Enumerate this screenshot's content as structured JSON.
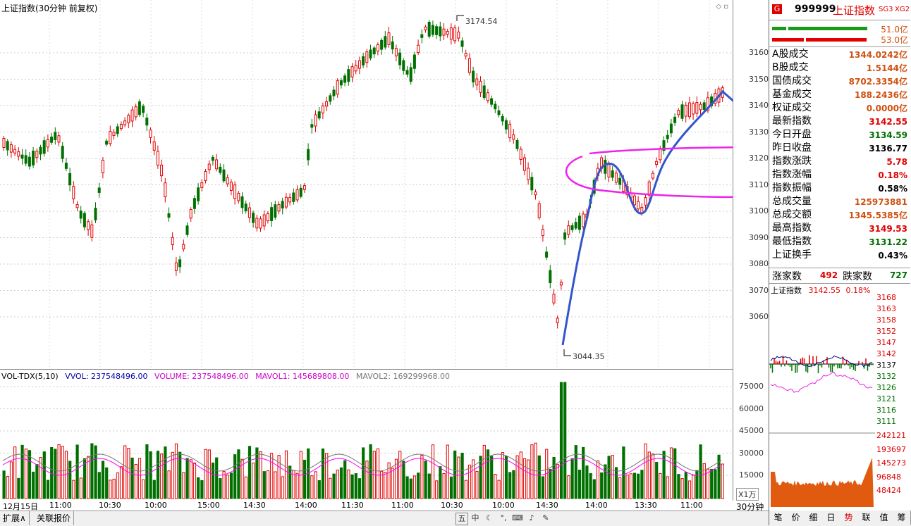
{
  "chart_title": "上证指数(30分钟 前复权)",
  "high_label": "3174.54",
  "low_label": "3044.35",
  "price_ticks": [
    "3160",
    "3150",
    "3140",
    "3130",
    "3120",
    "3110",
    "3100",
    "3090",
    "3080",
    "3070",
    "3060"
  ],
  "vol_ticks": [
    "75000",
    "60000",
    "45000",
    "30000",
    "15000"
  ],
  "vol_unit": "X1万",
  "period": "30分钟",
  "vol_legend": {
    "name": "VOL-TDX(5,10)",
    "vvol": "VVOL: 237548496.00",
    "volume": "VOLUME: 237548496.00",
    "mavol1": "MAVOL1: 145689808.00",
    "mavol2": "MAVOL2: 169299968.00"
  },
  "x_labels": [
    "12月15日",
    "11:00",
    "10:30",
    "10:00",
    "15:00",
    "14:30",
    "14:00",
    "11:30",
    "11:00",
    "10:30",
    "10:00",
    "14:30",
    "14:00",
    "13:30",
    "11:00"
  ],
  "bottom_tabs": [
    "扩展∧",
    "关联报价"
  ],
  "toolbar_icons": [
    "五",
    "中",
    "moon-icon",
    "dot-icon",
    "keyboard-icon",
    "speaker-icon",
    "tool-icon"
  ],
  "side": {
    "badge": "G",
    "code": "999999",
    "name": "上证指数",
    "tag1": "SG3",
    "tag2": "XG2",
    "bar1_value": "51.0亿",
    "bar2_value": "53.0亿",
    "rows": [
      {
        "label": "A股成交",
        "value": "1344.0242亿",
        "color": "orange"
      },
      {
        "label": "B股成交",
        "value": "1.5144亿",
        "color": "orange"
      },
      {
        "label": "国债成交",
        "value": "8702.3354亿",
        "color": "orange"
      },
      {
        "label": "基金成交",
        "value": "188.2436亿",
        "color": "orange"
      },
      {
        "label": "权证成交",
        "value": "0.0000亿",
        "color": "orange"
      },
      {
        "label": "最新指数",
        "value": "3142.55",
        "color": "red"
      },
      {
        "label": "今日开盘",
        "value": "3134.59",
        "color": "green"
      },
      {
        "label": "昨日收盘",
        "value": "3136.77",
        "color": "black"
      },
      {
        "label": "指数涨跌",
        "value": "5.78",
        "color": "red"
      },
      {
        "label": "指数涨幅",
        "value": "0.18%",
        "color": "red"
      },
      {
        "label": "指数振幅",
        "value": "0.58%",
        "color": "black"
      },
      {
        "label": "总成交量",
        "value": "125973881",
        "color": "orange"
      },
      {
        "label": "总成交额",
        "value": "1345.5385亿",
        "color": "orange"
      },
      {
        "label": "最高指数",
        "value": "3149.53",
        "color": "red"
      },
      {
        "label": "最低指数",
        "value": "3131.22",
        "color": "green"
      },
      {
        "label": "上证换手",
        "value": "0.43%",
        "color": "black"
      }
    ],
    "rise_label": "涨家数",
    "rise_value": "492",
    "fall_label": "跌家数",
    "fall_value": "727",
    "mini_title": "上证指数",
    "mini_price": "3142.55",
    "mini_pct": "0.18%",
    "mini_price_ticks": [
      "3168",
      "3163",
      "3158",
      "3152",
      "3147",
      "3142",
      "3137",
      "3132",
      "3126",
      "3121",
      "3116",
      "3111"
    ],
    "mini_vol_ticks": [
      "242121",
      "193697",
      "145273",
      "96848",
      "48424"
    ],
    "tabs": [
      "笔",
      "价",
      "细",
      "日",
      "势",
      "联",
      "值",
      "筹"
    ]
  },
  "colors": {
    "up": "#e00000",
    "down": "#007000",
    "ma1": "#ff00ff",
    "ma2": "#777777",
    "annot_blue": "#3355cc",
    "annot_magenta": "#ee22ee"
  }
}
